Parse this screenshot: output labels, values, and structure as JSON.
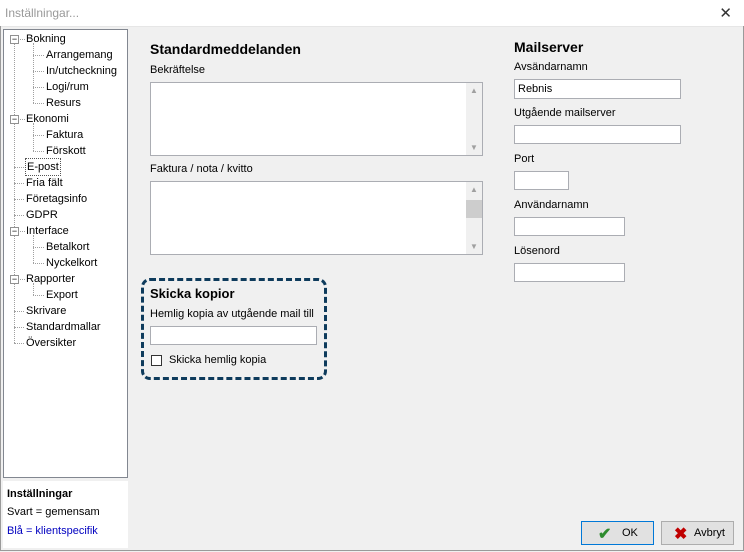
{
  "window": {
    "title": "Inställningar..."
  },
  "tree": {
    "items": [
      {
        "label": "Bokning",
        "level": 0,
        "expander": "−"
      },
      {
        "label": "Arrangemang",
        "level": 1
      },
      {
        "label": "In/utcheckning",
        "level": 1
      },
      {
        "label": "Logi/rum",
        "level": 1
      },
      {
        "label": "Resurs",
        "level": 1
      },
      {
        "label": "Ekonomi",
        "level": 0,
        "expander": "−"
      },
      {
        "label": "Faktura",
        "level": 1
      },
      {
        "label": "Förskott",
        "level": 1
      },
      {
        "label": "E-post",
        "level": 0,
        "selected": true
      },
      {
        "label": "Fria fält",
        "level": 0
      },
      {
        "label": "Företagsinfo",
        "level": 0
      },
      {
        "label": "GDPR",
        "level": 0
      },
      {
        "label": "Interface",
        "level": 0,
        "expander": "−"
      },
      {
        "label": "Betalkort",
        "level": 1
      },
      {
        "label": "Nyckelkort",
        "level": 1
      },
      {
        "label": "Rapporter",
        "level": 0,
        "expander": "−"
      },
      {
        "label": "Export",
        "level": 1
      },
      {
        "label": "Skrivare",
        "level": 0
      },
      {
        "label": "Standardmallar",
        "level": 0
      },
      {
        "label": "Översikter",
        "level": 0
      }
    ]
  },
  "legend": {
    "title": "Inställningar",
    "line1": "Svart = gemensam",
    "line2": "Blå = klientspecifik",
    "color2": "#0000c0"
  },
  "standard": {
    "heading": "Standardmeddelanden",
    "confirm_label": "Bekräftelse",
    "invoice_label": "Faktura / nota / kvitto"
  },
  "kopior": {
    "heading": "Skicka kopior",
    "bcc_label": "Hemlig kopia av utgående mail till",
    "bcc_value": "",
    "checkbox_label": "Skicka hemlig kopia"
  },
  "mailserver": {
    "heading": "Mailserver",
    "sender_label": "Avsändarnamn",
    "sender_value": "Rebnis",
    "outgoing_label": "Utgående mailserver",
    "outgoing_value": "",
    "port_label": "Port",
    "port_value": "",
    "user_label": "Användarnamn",
    "user_value": "",
    "password_label": "Lösenord",
    "password_value": ""
  },
  "buttons": {
    "ok": "OK",
    "cancel": "Avbryt"
  },
  "colors": {
    "highlight": "#0e3b5c",
    "ok_icon": "#2e8b2e",
    "cancel_icon": "#c00000"
  }
}
